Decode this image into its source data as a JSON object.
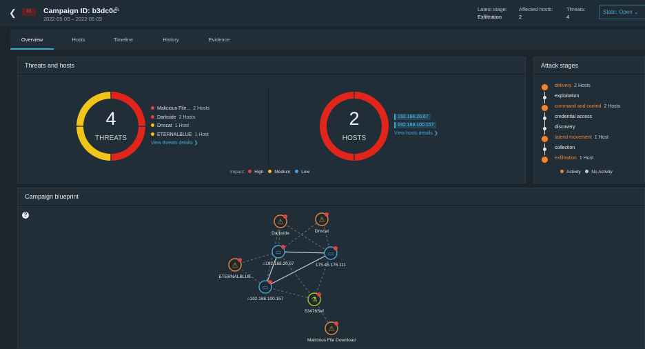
{
  "header": {
    "back_icon": "chevron-left-icon",
    "severity_badge": "83",
    "title": "Campaign ID: b3dc0c",
    "edit_icon": "pencil-icon",
    "dates": "2022-05-09 – 2022-05-09",
    "stats": [
      {
        "label": "Latest stage:",
        "value": "Exfiltration"
      },
      {
        "label": "Affected hosts:",
        "value": "2"
      },
      {
        "label": "Threats:",
        "value": "4"
      }
    ],
    "state_label": "State: Open",
    "state_icon": "chevron-down-icon"
  },
  "tabs": [
    {
      "label": "Overview",
      "active": true
    },
    {
      "label": "Hosts"
    },
    {
      "label": "Timeline"
    },
    {
      "label": "History"
    },
    {
      "label": "Evidence"
    }
  ],
  "threats_hosts": {
    "title": "Threats and hosts",
    "threats": {
      "count": "4",
      "label": "THREATS",
      "items": [
        {
          "name": "Malicious File...",
          "count": "2 Hosts",
          "impact": "high"
        },
        {
          "name": "Darkside",
          "count": "2 Hosts",
          "impact": "high"
        },
        {
          "name": "Dnscat",
          "count": "1 Host",
          "impact": "medium"
        },
        {
          "name": "ETERNALBLUE",
          "count": "1 Host",
          "impact": "medium"
        }
      ],
      "details_link": "View threats details ❯"
    },
    "hosts": {
      "count": "2",
      "label": "HOSTS",
      "items": [
        "192.168.20.67",
        "192.168.100.157"
      ],
      "details_link": "View hosts details ❯"
    },
    "impact_legend": {
      "label": "Impact:",
      "items": [
        {
          "label": "High",
          "color": "#e04545"
        },
        {
          "label": "Medium",
          "color": "#f0c419"
        },
        {
          "label": "Low",
          "color": "#3fa6d6"
        }
      ]
    }
  },
  "colors": {
    "high": "#e0251b",
    "medium": "#f0c419",
    "low": "#3fa6d6",
    "activity": "#e8873a",
    "accent": "#3fa6d6"
  },
  "attack_stages": {
    "title": "Attack stages",
    "stages": [
      {
        "name": "delivery",
        "count": "2 Hosts",
        "active": true
      },
      {
        "name": "exploitation",
        "active": false
      },
      {
        "name": "command and control",
        "count": "2 Hosts",
        "active": true
      },
      {
        "name": "credential access",
        "active": false
      },
      {
        "name": "discovery",
        "active": false
      },
      {
        "name": "lateral movement",
        "count": "1 Host",
        "active": true
      },
      {
        "name": "collection",
        "active": false
      },
      {
        "name": "exfiltration",
        "count": "1 Host",
        "active": true
      }
    ],
    "legend": {
      "activity": "Activity",
      "no_activity": "No Activity"
    }
  },
  "blueprint": {
    "title": "Campaign blueprint",
    "help_icon": "question-circle-icon",
    "nodes": [
      {
        "id": "darkside",
        "label": "Darkside",
        "type": "threat",
        "icon": "warning-icon"
      },
      {
        "id": "dnscat",
        "label": "Dnscat",
        "type": "threat",
        "icon": "warning-icon"
      },
      {
        "id": "h1",
        "label": "192.168.20.67",
        "type": "host",
        "icon": "laptop-icon",
        "home": true
      },
      {
        "id": "ext",
        "label": "175.45.176.111",
        "type": "host",
        "icon": "laptop-icon"
      },
      {
        "id": "eternal",
        "label": "ETERNALBLUE",
        "type": "threat",
        "icon": "warning-icon"
      },
      {
        "id": "h2",
        "label": "192.168.100.157",
        "type": "host",
        "icon": "laptop-icon",
        "home": true
      },
      {
        "id": "file",
        "label": "53476Sef",
        "type": "file",
        "icon": "flask-icon"
      },
      {
        "id": "mfd",
        "label": "Malicious File Download",
        "type": "threat",
        "icon": "warning-icon"
      }
    ],
    "edges": [
      {
        "from": "h1",
        "to": "ext",
        "style": "solid"
      },
      {
        "from": "h2",
        "to": "h1",
        "style": "solid"
      },
      {
        "from": "h2",
        "to": "ext",
        "style": "solid"
      },
      {
        "from": "darkside",
        "to": "h1",
        "style": "dashed"
      },
      {
        "from": "darkside",
        "to": "ext",
        "style": "dashed"
      },
      {
        "from": "dnscat",
        "to": "ext",
        "style": "dashed"
      },
      {
        "from": "h1",
        "to": "dnscat",
        "style": "dashed"
      },
      {
        "from": "eternal",
        "to": "h1",
        "style": "dashed"
      },
      {
        "from": "eternal",
        "to": "h2",
        "style": "dashed"
      },
      {
        "from": "h1",
        "to": "file",
        "style": "dashed"
      },
      {
        "from": "h2",
        "to": "file",
        "style": "dashed"
      },
      {
        "from": "ext",
        "to": "file",
        "style": "dashed"
      },
      {
        "from": "file",
        "to": "mfd",
        "style": "dashed"
      },
      {
        "from": "darkside",
        "to": "h2",
        "style": "dashed"
      }
    ]
  }
}
